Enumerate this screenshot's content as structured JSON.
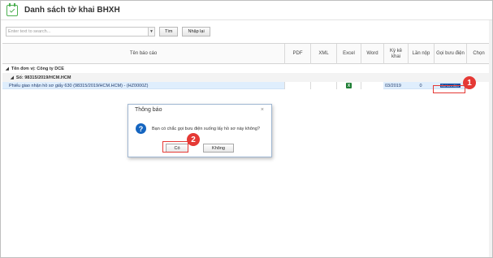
{
  "window": {
    "title": "Danh sách tờ khai BHXH",
    "icon": "calendar-check-icon"
  },
  "toolbar": {
    "search_placeholder": "Enter text to search...",
    "dropdown_icon": "chevron-down-icon",
    "find_label": "Tìm",
    "reset_label": "Nhập lại"
  },
  "grid": {
    "columns": {
      "name": "Tên báo cáo",
      "pdf": "PDF",
      "xml": "XML",
      "excel": "Excel",
      "word": "Word",
      "period": "Kỳ kê khai",
      "times": "Lần nộp",
      "post": "Gọi bưu điện",
      "select": "Chọn"
    },
    "group1": "Tên đơn vị: Công ty DCE",
    "group2": "Số: 98315/2019/HCM.HCM",
    "row": {
      "name": "Phiếu giao nhận hồ sơ giấy 630 (98315/2019/HCM.HCM) - (HZ0000Z)",
      "excel_icon": "excel-file-icon",
      "period": "03/2019",
      "times": "0",
      "post_button": "Gọi bưu điện"
    }
  },
  "dialog": {
    "title": "Thông báo",
    "close": "×",
    "icon": "question-icon",
    "message": "Bạn có chắc gọi bưu điện xuống lấy hồ sơ này không?",
    "yes": "Có",
    "no": "Không"
  },
  "callouts": {
    "step1": "1",
    "step2": "2"
  },
  "colors": {
    "accent": "#4caf50",
    "selection": "#dfeefd",
    "callout": "#e53935",
    "post_button": "#1a4fa0"
  }
}
